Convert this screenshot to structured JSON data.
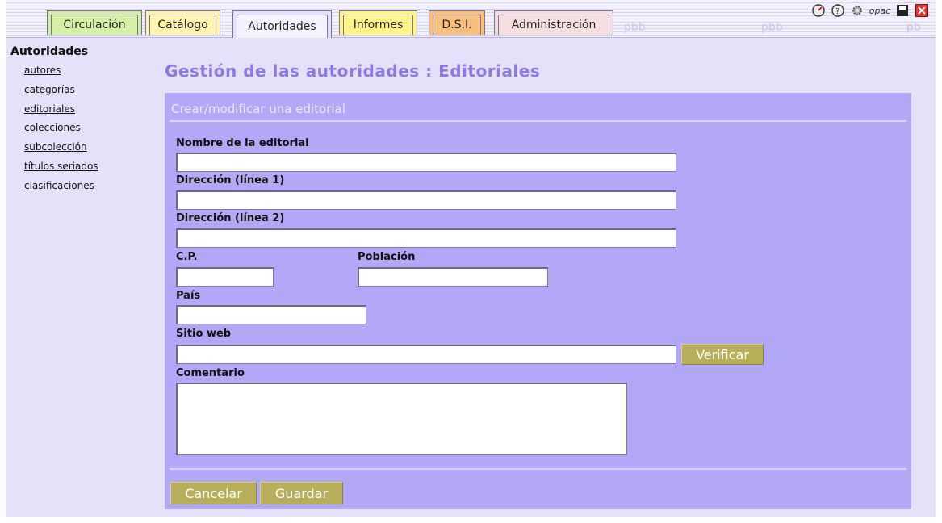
{
  "tabs": [
    {
      "label": "Circulación",
      "color": "#d4f0a4"
    },
    {
      "label": "Catálogo",
      "color": "#fff4ad"
    },
    {
      "label": "Autoridades",
      "color": "#e7e0fb"
    },
    {
      "label": "Informes",
      "color": "#fff48a"
    },
    {
      "label": "D.S.I.",
      "color": "#f7c07e"
    },
    {
      "label": "Administración",
      "color": "#f6dede"
    }
  ],
  "header": {
    "faint_marks": [
      "pbb",
      "pbb",
      "pb"
    ]
  },
  "top_icons": [
    "dashboard-icon",
    "help-icon",
    "settings-icon",
    "opac-icon",
    "save-icon",
    "close-icon"
  ],
  "top_icon_glyphs": {
    "opac": "opac"
  },
  "sidebar": {
    "title": "Autoridades",
    "items": [
      "autores",
      "categorías",
      "editoriales",
      "colecciones",
      "subcolección",
      "títulos seriados",
      "clasificaciones"
    ]
  },
  "page": {
    "title": "Gestión de las autoridades : Editoriales"
  },
  "form": {
    "heading": "Crear/modificar una editorial",
    "fields": {
      "name": {
        "label": "Nombre de la editorial",
        "value": ""
      },
      "address1": {
        "label": "Dirección (línea 1)",
        "value": ""
      },
      "address2": {
        "label": "Dirección (línea 2)",
        "value": ""
      },
      "postcode": {
        "label": "C.P.",
        "value": ""
      },
      "city": {
        "label": "Población",
        "value": ""
      },
      "country": {
        "label": "País",
        "value": ""
      },
      "website": {
        "label": "Sitio web",
        "value": ""
      },
      "comment": {
        "label": "Comentario",
        "value": ""
      }
    },
    "verify_label": "Verificar",
    "cancel_label": "Cancelar",
    "save_label": "Guardar"
  }
}
